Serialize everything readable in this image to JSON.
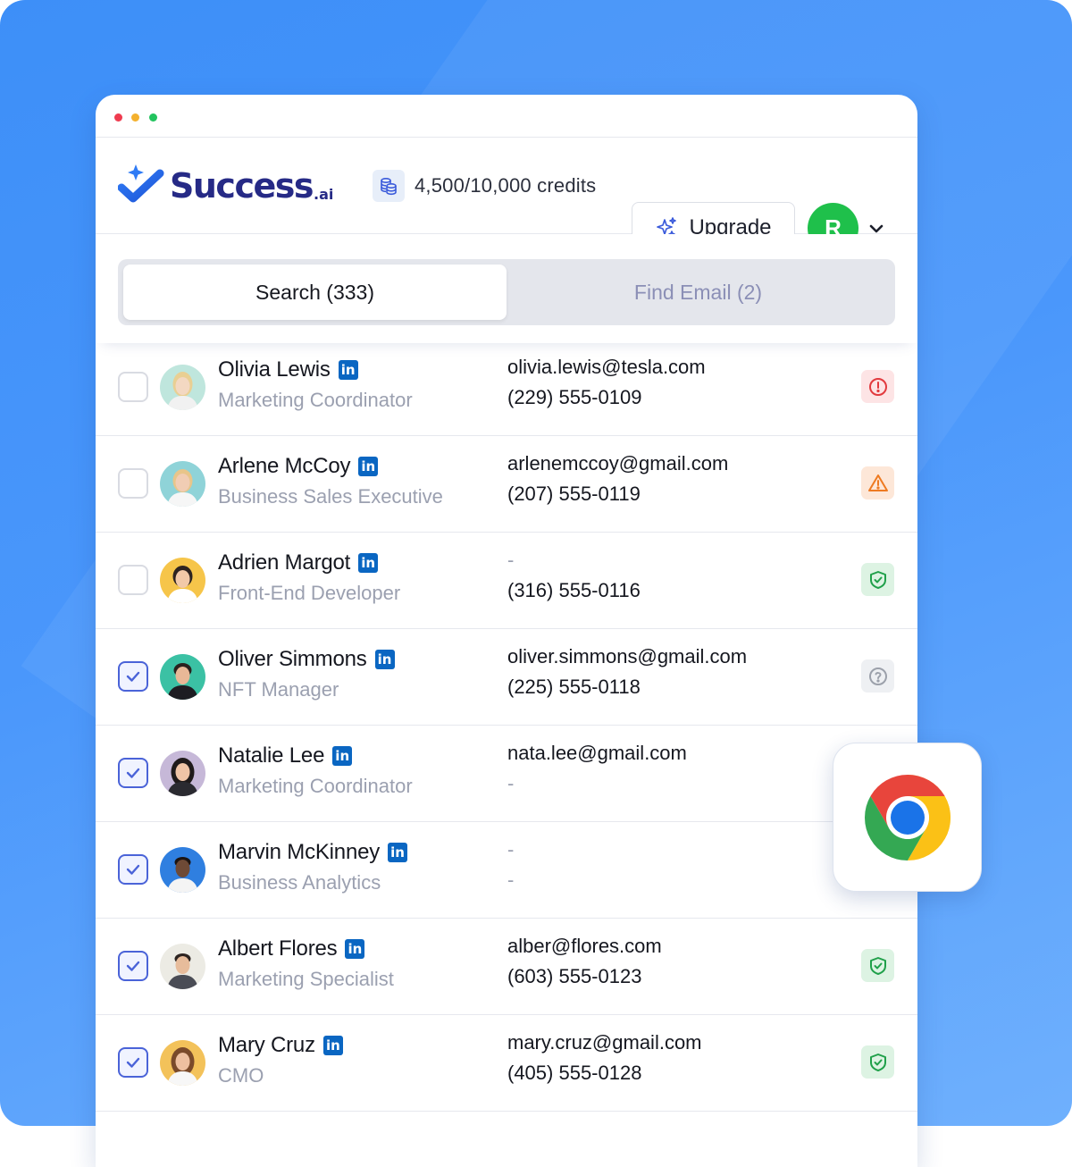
{
  "app": {
    "logo_text": "Success",
    "logo_suffix": ".ai"
  },
  "header": {
    "credits": "4,500/10,000 credits",
    "upgrade_label": "Upgrade",
    "avatar_initial": "R"
  },
  "tabs": [
    {
      "label": "Search (333)",
      "active": true
    },
    {
      "label": "Find Email (2)",
      "active": false
    }
  ],
  "contacts": [
    {
      "name": "Olivia Lewis",
      "title": "Marketing Coordinator",
      "email": "olivia.lewis@tesla.com",
      "phone": "(229) 555-0109",
      "checked": false,
      "status": "error"
    },
    {
      "name": "Arlene McCoy",
      "title": "Business Sales Executive",
      "email": "arlenemccoy@gmail.com",
      "phone": "(207) 555-0119",
      "checked": false,
      "status": "warning"
    },
    {
      "name": "Adrien Margot",
      "title": "Front-End Developer",
      "email": "-",
      "phone": "(316) 555-0116",
      "checked": false,
      "status": "verified"
    },
    {
      "name": "Oliver Simmons",
      "title": "NFT Manager",
      "email": "oliver.simmons@gmail.com",
      "phone": "(225) 555-0118",
      "checked": true,
      "status": "unknown"
    },
    {
      "name": "Natalie Lee",
      "title": "Marketing Coordinator",
      "email": "nata.lee@gmail.com",
      "phone": "-",
      "checked": true,
      "status": "none"
    },
    {
      "name": "Marvin McKinney",
      "title": "Business Analytics",
      "email": "-",
      "phone": "-",
      "checked": true,
      "status": "none"
    },
    {
      "name": "Albert Flores",
      "title": "Marketing Specialist",
      "email": "alber@flores.com",
      "phone": "(603) 555-0123",
      "checked": true,
      "status": "verified"
    },
    {
      "name": "Mary Cruz",
      "title": "CMO",
      "email": "mary.cruz@gmail.com",
      "phone": "(405) 555-0128",
      "checked": true,
      "status": "verified"
    }
  ],
  "linkedin_badge": "in",
  "colors": {
    "brand": "#262a86",
    "accent_green": "#1fc04b",
    "linkedin": "#0a66c2",
    "checkbox_active": "#4a63d8"
  },
  "icons": {
    "status_error": "alert-circle-icon",
    "status_warning": "alert-triangle-icon",
    "status_verified": "shield-check-icon",
    "status_unknown": "question-circle-icon",
    "extension": "chrome-icon"
  }
}
